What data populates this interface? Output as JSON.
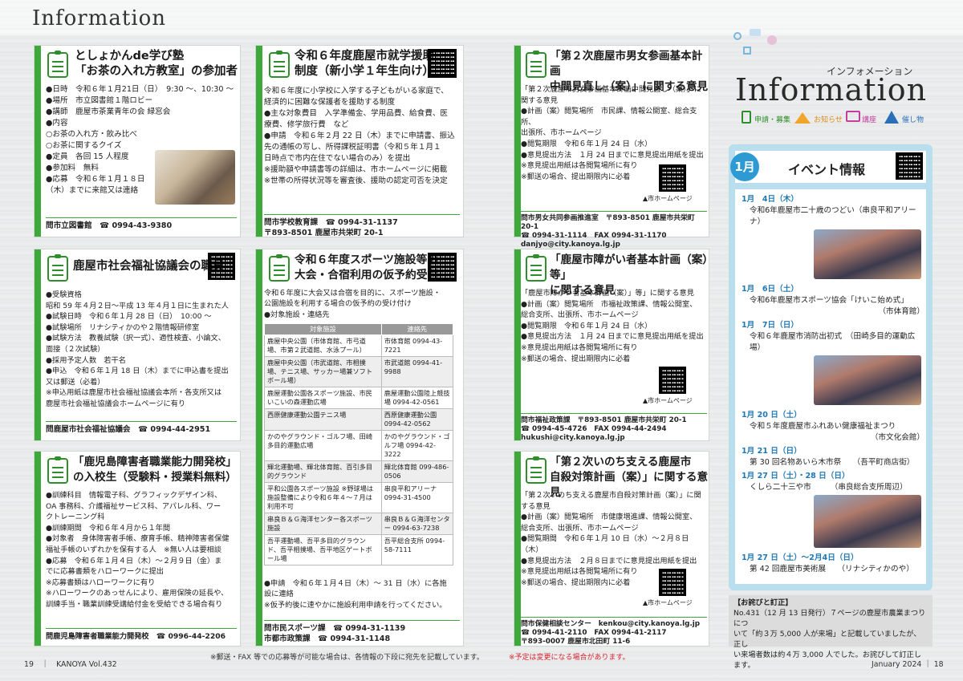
{
  "header": {
    "title": "Information"
  },
  "c1": {
    "title1": "としょかんde学び塾",
    "title2": "「お茶の入れ方教室」の参加者",
    "l1": "●日時　令和６年１月21日（日）　9:30 ～、10:30 ～",
    "l2": "●場所　市立図書館１階ロビー",
    "l3": "●講師　鹿屋市茶業青年の会 緑窓会",
    "l4": "●内容",
    "l5": "○お茶の入れ方・飲み比べ",
    "l6": "○お茶に関するクイズ",
    "l7": "●定員　各回 15 人程度",
    "l8": "●参加料　無料",
    "l9": "●応募　令和６年１月１８日",
    "l10": "（木）までに来館又は連絡",
    "tel": "問市立図書館　☎ 0994-43-9380"
  },
  "c2": {
    "title1": "令和６年度鹿屋市就学援助",
    "title2": "制度（新小学１年生向け）",
    "l1": "令和６年度に小学校に入学する子どもがいる家庭で、",
    "l2": "経済的に困難な保護者を援助する制度",
    "l3": "●主な対象費目　入学準備金、学用品費、給食費、医",
    "l4": "療費、修学旅行費　など",
    "l5": "●申請　令和６年２月 22 日（木）までに申請書、振込",
    "l6": "先の通帳の写し、所得課税証明書（令和５年１月１",
    "l7": "日時点で市内在住でない場合のみ）を提出",
    "l8": "※援助額や申請書等の詳細は、市ホームページに掲載",
    "l9": "※世帯の所得状況等を審査後、援助の認定可否を決定",
    "tel1": "問市学校教育課　☎ 0994-31-1137",
    "tel2": "〒893-8501 鹿屋市共栄町 20-1"
  },
  "c3": {
    "title1": "「第２次鹿屋市男女参画基本計画",
    "title2": "中間見直し（案）」に関する意見",
    "l1": "「第２次鹿屋市男女参画基本計画中間見直し（案）」に",
    "l2": "関する意見",
    "l3": "●計画（案）閲覧場所　市民課、情報公開室、総合支所、",
    "l4": "出張所、市ホームページ",
    "l5": "●閲覧期限　令和６年１月 24 日（水）",
    "l6": "●意見提出方法　１月 24 日までに意見提出用紙を提出",
    "l7": "※意見提出用紙は各閲覧場所に有り",
    "l8": "※郵送の場合、提出期限内に必着",
    "qr": "▲市ホームページ",
    "tel1": "問市男女共同参画推進室　〒893-8501 鹿屋市共栄町 20-1",
    "tel2": "☎ 0994-31-1114　FAX 0994-31-1170",
    "tel3": "danjyo@city.kanoya.lg.jp"
  },
  "c4": {
    "title1": "鹿屋市社会福祉協議会の職員",
    "l1": "●受験資格",
    "l2": "昭和 59 年４月２日～平成 13 年４月１日に生まれた人",
    "l3": "●試験日時　令和６年１月 28 日（日）　10:00 ～",
    "l4": "●試験場所　リナシティかのや２階情報研修室",
    "l5": "●試験方法　教養試験（択一式）、適性検査、小論文、",
    "l6": "面接（２次試験）",
    "l7": "●採用予定人数　若干名",
    "l8": "●申込　令和６年１月 18 日（木）までに申込書を提出",
    "l9": "又は郵送（必着）",
    "l10": "※申込用紙は鹿屋市社会福祉協議会本所・各支所又は",
    "l11": "鹿屋市社会福祉協議会ホームページに有り",
    "tel": "問鹿屋市社会福祉協議会　☎ 0994-44-2951"
  },
  "c5": {
    "title1": "令和６年度スポーツ施設等の",
    "title2": "大会・合宿利用の仮予約受付",
    "l1": "令和６年度に大会又は合宿を目的に、スポーツ施設・",
    "l2": "公園施設を利用する場合の仮予約の受け付け",
    "l3": "●対象施設・連絡先",
    "th1": "対象施設",
    "th2": "連絡先",
    "rows": [
      [
        "鹿屋中央公園（市体育館、市弓道場、市第２武道館、水泳プール）",
        "市体育館 0994-43-7221"
      ],
      [
        "鹿屋中央公園（市武道館、市相撲場、テニス場、サッカー場兼ソフトボール場）",
        "市武道館 0994-41-9988"
      ],
      [
        "鹿屋運動公園各スポーツ施設、市民いこいの森運動広場",
        "鹿屋運動公園陸上競技場 0994-42-0561"
      ],
      [
        "西原健康運動公園テニス場",
        "西原健康運動公園 0994-42-0562"
      ],
      [
        "かのやグラウンド・ゴルフ場、田崎多目的運動広場",
        "かのやグラウンド・ゴルフ場 0994-42-3222"
      ],
      [
        "輝北運動場、輝北体育館、百引多目的グラウンド",
        "輝北体育館 099-486-0506"
      ],
      [
        "平和公園各スポーツ施設 ※野球場は施設整備により令和６年４～７月は利用不可",
        "串良平和アリーナ 0994-31-4500"
      ],
      [
        "串良Ｂ＆Ｇ海洋センター各スポーツ施設",
        "串良Ｂ＆Ｇ海洋センター 0994-63-7238"
      ],
      [
        "吾平運動場、吾平多目的グラウンド、吾平相撲場、吾平地区ゲートボール場",
        "吾平総合支所 0994-58-7111"
      ]
    ],
    "l4": "●申請　令和６年１月４日（木）～ 31 日（水）に各施",
    "l5": "設に連絡",
    "l6": "※仮予約後に速やかに施設利用申請を行ってください。",
    "tel1": "問市民スポーツ課　☎ 0994-31-1139",
    "tel2": "市都市政策課　☎ 0994-31-1148"
  },
  "c6": {
    "title1": "「鹿屋市障がい者基本計画（案）等」",
    "title2": "に関する意見",
    "l1": "「鹿屋市障がい者基本計画（案）」等」に関する意見",
    "l2": "●計画（案）閲覧場所　市福祉政策課、情報公開室、",
    "l3": "総合支所、出張所、市ホームページ",
    "l4": "●閲覧期限　令和６年１月 24 日（水）",
    "l5": "●意見提出方法　１月 24 日までに意見提出用紙を提出",
    "l6": "※意見提出用紙は各閲覧場所に有り",
    "l7": "※郵送の場合、提出期限内に必着",
    "qr": "▲市ホームページ",
    "tel1": "問市福祉政策課　〒893-8501 鹿屋市共栄町 20-1",
    "tel2": "☎ 0994-45-4726　FAX 0994-44-2494",
    "tel3": "hukushi@city.kanoya.lg.jp"
  },
  "c7": {
    "title1": "「鹿児島障害者職業能力開発校」",
    "title2": "の入校生（受験料・授業料無料）",
    "l1": "●訓練科目　情報電子科、グラフィックデザイン科、",
    "l2": "OA 事務科、介護福祉サービス科、アパレル科、ワー",
    "l3": "クトレーニング科",
    "l4": "●訓練期間　令和６年４月から１年間",
    "l5": "●対象者　身体障害者手帳、療育手帳、精神障害者保健",
    "l6": "福祉手帳のいずれかを保有する人　※無い人は要相談",
    "l7": "●応募　令和６年１月４日（木）～２月９日（金）ま",
    "l8": "でに応募書類をハローワークに提出",
    "l9": "※応募書類はハローワークに有り",
    "l10": "※ハローワークのあっせんにより、雇用保険の延長や、",
    "l11": "訓練手当・職業訓練受講給付金を受給できる場合有り",
    "tel": "問鹿児島障害者職業能力開発校　☎ 0996-44-2206"
  },
  "c8": {
    "title1": "「第２次いのち支える鹿屋市",
    "title2": "自殺対策計画（案）」に関する意見",
    "l1": "「第２次いのち支える鹿屋市自殺対策計画（案）」に関",
    "l2": "する意見",
    "l3": "●計画（案）閲覧場所　市健康増進課、情報公開室、",
    "l4": "総合支所、出張所、市ホームページ",
    "l5": "●閲覧期間　令和６年１月 10 日（水）～２月８日（木）",
    "l6": "●意見提出方法　２月８日までに意見提出用紙を提出",
    "l7": "※意見提出用紙は各閲覧場所に有り",
    "l8": "※郵送の場合、提出期限内に必着",
    "qr": "▲市ホームページ",
    "tel1": "問市保健相談センター　kenkou@city.kanoya.lg.jp",
    "tel2": "☎ 0994-41-2110　FAX 0994-41-2117",
    "tel3": "〒893-0007 鹿屋市北田町 11-6"
  },
  "right": {
    "kana": "インフォメーション",
    "big": "Information",
    "cat1": "申請・募集",
    "cat2": "お知らせ",
    "cat3": "講座",
    "cat4": "催し物",
    "ev_month": "1月",
    "ev_title": "イベント情報",
    "events": [
      {
        "d": "1月　4日（木）",
        "t": "令和6年鹿屋市二十歳のつどい（串良平和アリーナ）",
        "p": ""
      },
      {
        "d": "1月　6日（土）",
        "t": "令和6年鹿屋市スポーツ協会「けいこ始め式」",
        "p": "（市体育館）"
      },
      {
        "d": "1月　7日（日）",
        "t": "令和６年鹿屋市消防出初式　（田崎多目的運動広場）",
        "p": ""
      },
      {
        "d": "1月 20 日（土）",
        "t": "令和５年度鹿屋市ふれあい健康福祉まつり",
        "p": "（市文化会館）"
      },
      {
        "d": "1月 21 日（日）",
        "t": "第 30 回名物あいら木市祭　　（吾平町商店街）",
        "p": ""
      },
      {
        "d": "1月 27 日（土）・28 日（日）",
        "t": "くしら二十三や市　　　（串良総合支所周辺）",
        "p": ""
      },
      {
        "d": "1月 27 日（土）～2月4日（日）",
        "t": "第 42 回鹿屋市美術展　　（リナシティかのや）",
        "p": ""
      }
    ],
    "note_title": "【お詫びと訂正】",
    "note1": "No.431（12 月 13 日発行）７ページの鹿屋市農業まつりにつ",
    "note2": "いて「約３万 5,000 人が来場」と記載していましたが、正し",
    "note3": "い来場者数は約４万 3,000 人でした。お詫びして訂正します。"
  },
  "footer": {
    "left_page": "19",
    "left_mag": "KANOYA Vol.432",
    "notice": "※郵送・FAX 等での応募等が可能な場合は、各情報の下段に宛先を記載しています。",
    "notice2": "※予定は変更になる場合があります。",
    "right": "January 2024 ｜ 18"
  }
}
